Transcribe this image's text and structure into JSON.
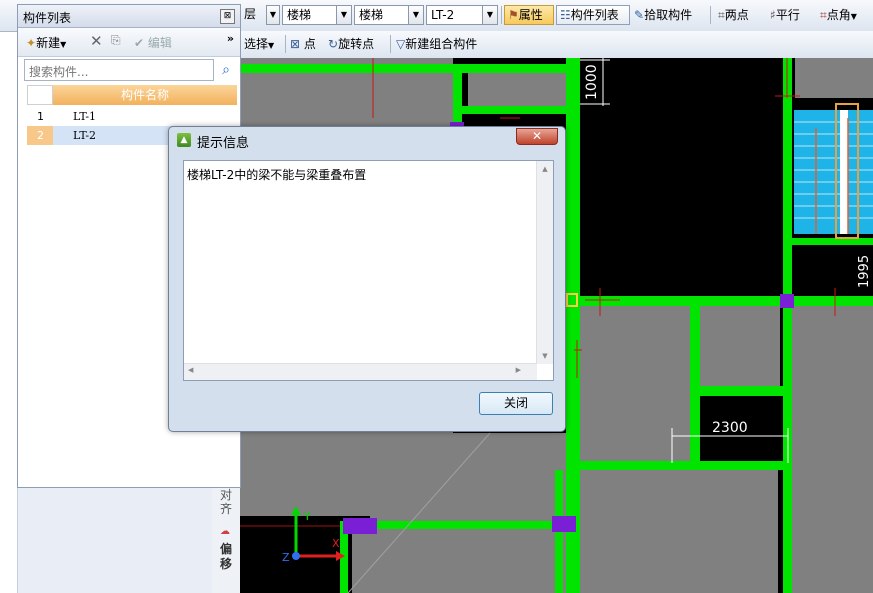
{
  "toolbar": {
    "floor_combo": "层",
    "category_combo": "楼梯",
    "type_combo": "楼梯",
    "component_combo": "LT-2",
    "properties_label": "属性",
    "component_list_label": "构件列表",
    "pick_component_label": "拾取构件",
    "two_points_label": "两点",
    "parallel_label": "平行",
    "point_angle_label": "点角",
    "select_label": "选择",
    "point_label": "点",
    "rotate_point_label": "旋转点",
    "new_group_label": "新建组合构件"
  },
  "panel": {
    "title": "构件列表",
    "new_label": "新建",
    "edit_label": "编辑",
    "search_placeholder": "搜索构件...",
    "column_header": "构件名称",
    "rows": [
      {
        "index": "1",
        "name": "LT-1"
      },
      {
        "index": "2",
        "name": "LT-2"
      }
    ]
  },
  "side_tools": {
    "align_label": "对齐",
    "offset_label": "偏移"
  },
  "dialog": {
    "title": "提示信息",
    "message": "楼梯LT-2中的梁不能与梁重叠布置",
    "close_label": "关闭"
  },
  "canvas": {
    "dimensions": [
      "1000",
      "2300",
      "1995"
    ],
    "axis_y": "Y",
    "axis_z": "Z",
    "axis_x": "X"
  }
}
